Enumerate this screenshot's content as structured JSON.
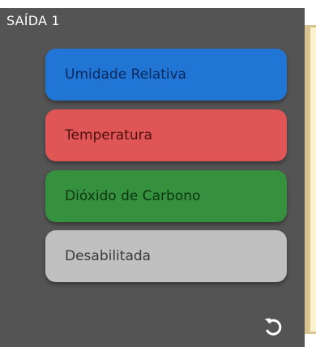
{
  "panel": {
    "title": "SAÍDA 1"
  },
  "options": [
    {
      "label": "Umidade Relativa",
      "color": "#2175d5"
    },
    {
      "label": "Temperatura",
      "color": "#e05555"
    },
    {
      "label": "Dióxido de Carbono",
      "color": "#36913f"
    },
    {
      "label": "Desabilitada",
      "color": "#c0c0c0"
    }
  ],
  "reset": {
    "icon": "reset-icon"
  }
}
